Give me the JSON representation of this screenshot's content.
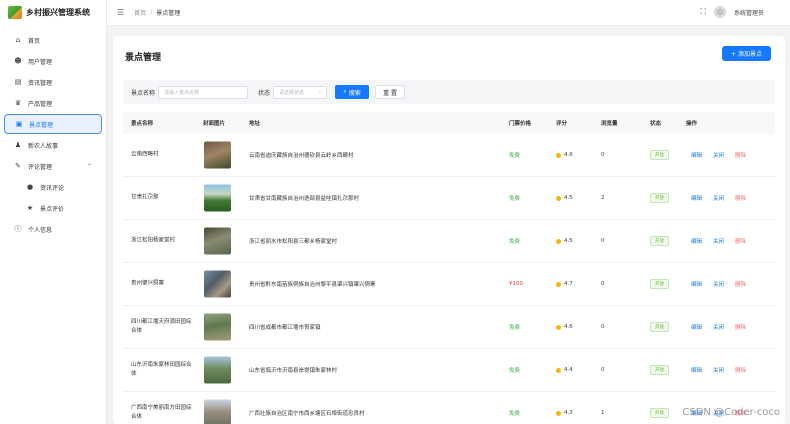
{
  "app": {
    "title": "乡村振兴管理系统"
  },
  "sidebar": {
    "items": [
      {
        "label": "首页",
        "icon": "home-icon"
      },
      {
        "label": "用户管理",
        "icon": "users-icon"
      },
      {
        "label": "资讯管理",
        "icon": "news-icon"
      },
      {
        "label": "产品管理",
        "icon": "product-icon"
      },
      {
        "label": "景点管理",
        "icon": "scenic-icon",
        "active": true
      },
      {
        "label": "新农人故事",
        "icon": "person-icon"
      },
      {
        "label": "评论管理",
        "icon": "comment-icon"
      },
      {
        "label": "资讯评论",
        "icon": "chat-icon"
      },
      {
        "label": "景点评价",
        "icon": "star-icon"
      },
      {
        "label": "个人信息",
        "icon": "info-icon"
      }
    ]
  },
  "header": {
    "breadcrumb": [
      "首页",
      "景点管理"
    ],
    "user": "系统管理员"
  },
  "main": {
    "title": "景点管理",
    "add_button": "+ 添加景点",
    "filter": {
      "name_label": "景点名称",
      "name_placeholder": "请输入景点名称",
      "status_label": "状态",
      "status_placeholder": "请选择状态",
      "search_button": "搜索",
      "reset_button": "重 置"
    },
    "table": {
      "columns": [
        "景点名称",
        "封面图片",
        "地址",
        "门票价格",
        "评分",
        "浏览量",
        "状态",
        "操作"
      ],
      "ops": {
        "edit": "编辑",
        "close": "关闭",
        "delete": "删除"
      },
      "rows": [
        {
          "name": "云南西畴村",
          "address": "云南省迪庆藏族自治州德钦县云岭乡西畴村",
          "price": "免费",
          "rating": "4.6",
          "views": "0",
          "status": "开放"
        },
        {
          "name": "甘肃扎尕那",
          "address": "甘肃省甘南藏族自治州迭部县益哇镇扎尕那村",
          "price": "免费",
          "rating": "4.5",
          "views": "2",
          "status": "开放"
        },
        {
          "name": "浙江松阳杨家堂村",
          "address": "浙江省丽水市松阳县三都乡杨家堂村",
          "price": "免费",
          "rating": "4.5",
          "views": "0",
          "status": "开放"
        },
        {
          "name": "贵州肇兴侗寨",
          "address": "贵州省黔东南苗族侗族自治州黎平县肇兴镇肇兴侗寨",
          "price": "¥100",
          "rating": "4.7",
          "views": "0",
          "status": "开放"
        },
        {
          "name": "四川都江堰天府源田园综合体",
          "address": "四川省成都市都江堰市胥家镇",
          "price": "免费",
          "rating": "4.6",
          "views": "0",
          "status": "开放"
        },
        {
          "name": "山东沂南朱家林田园综合体",
          "address": "山东省临沂市沂南县岸堤镇朱家林村",
          "price": "免费",
          "rating": "4.4",
          "views": "0",
          "status": "开放"
        },
        {
          "name": "广西南宁美丽南方田园综合体",
          "address": "广西壮族自治区南宁市西乡塘区石埠街道忠良村",
          "price": "免费",
          "rating": "4.3",
          "views": "1",
          "status": "开放"
        }
      ]
    }
  },
  "watermark": "CSDN @Coder-coco"
}
